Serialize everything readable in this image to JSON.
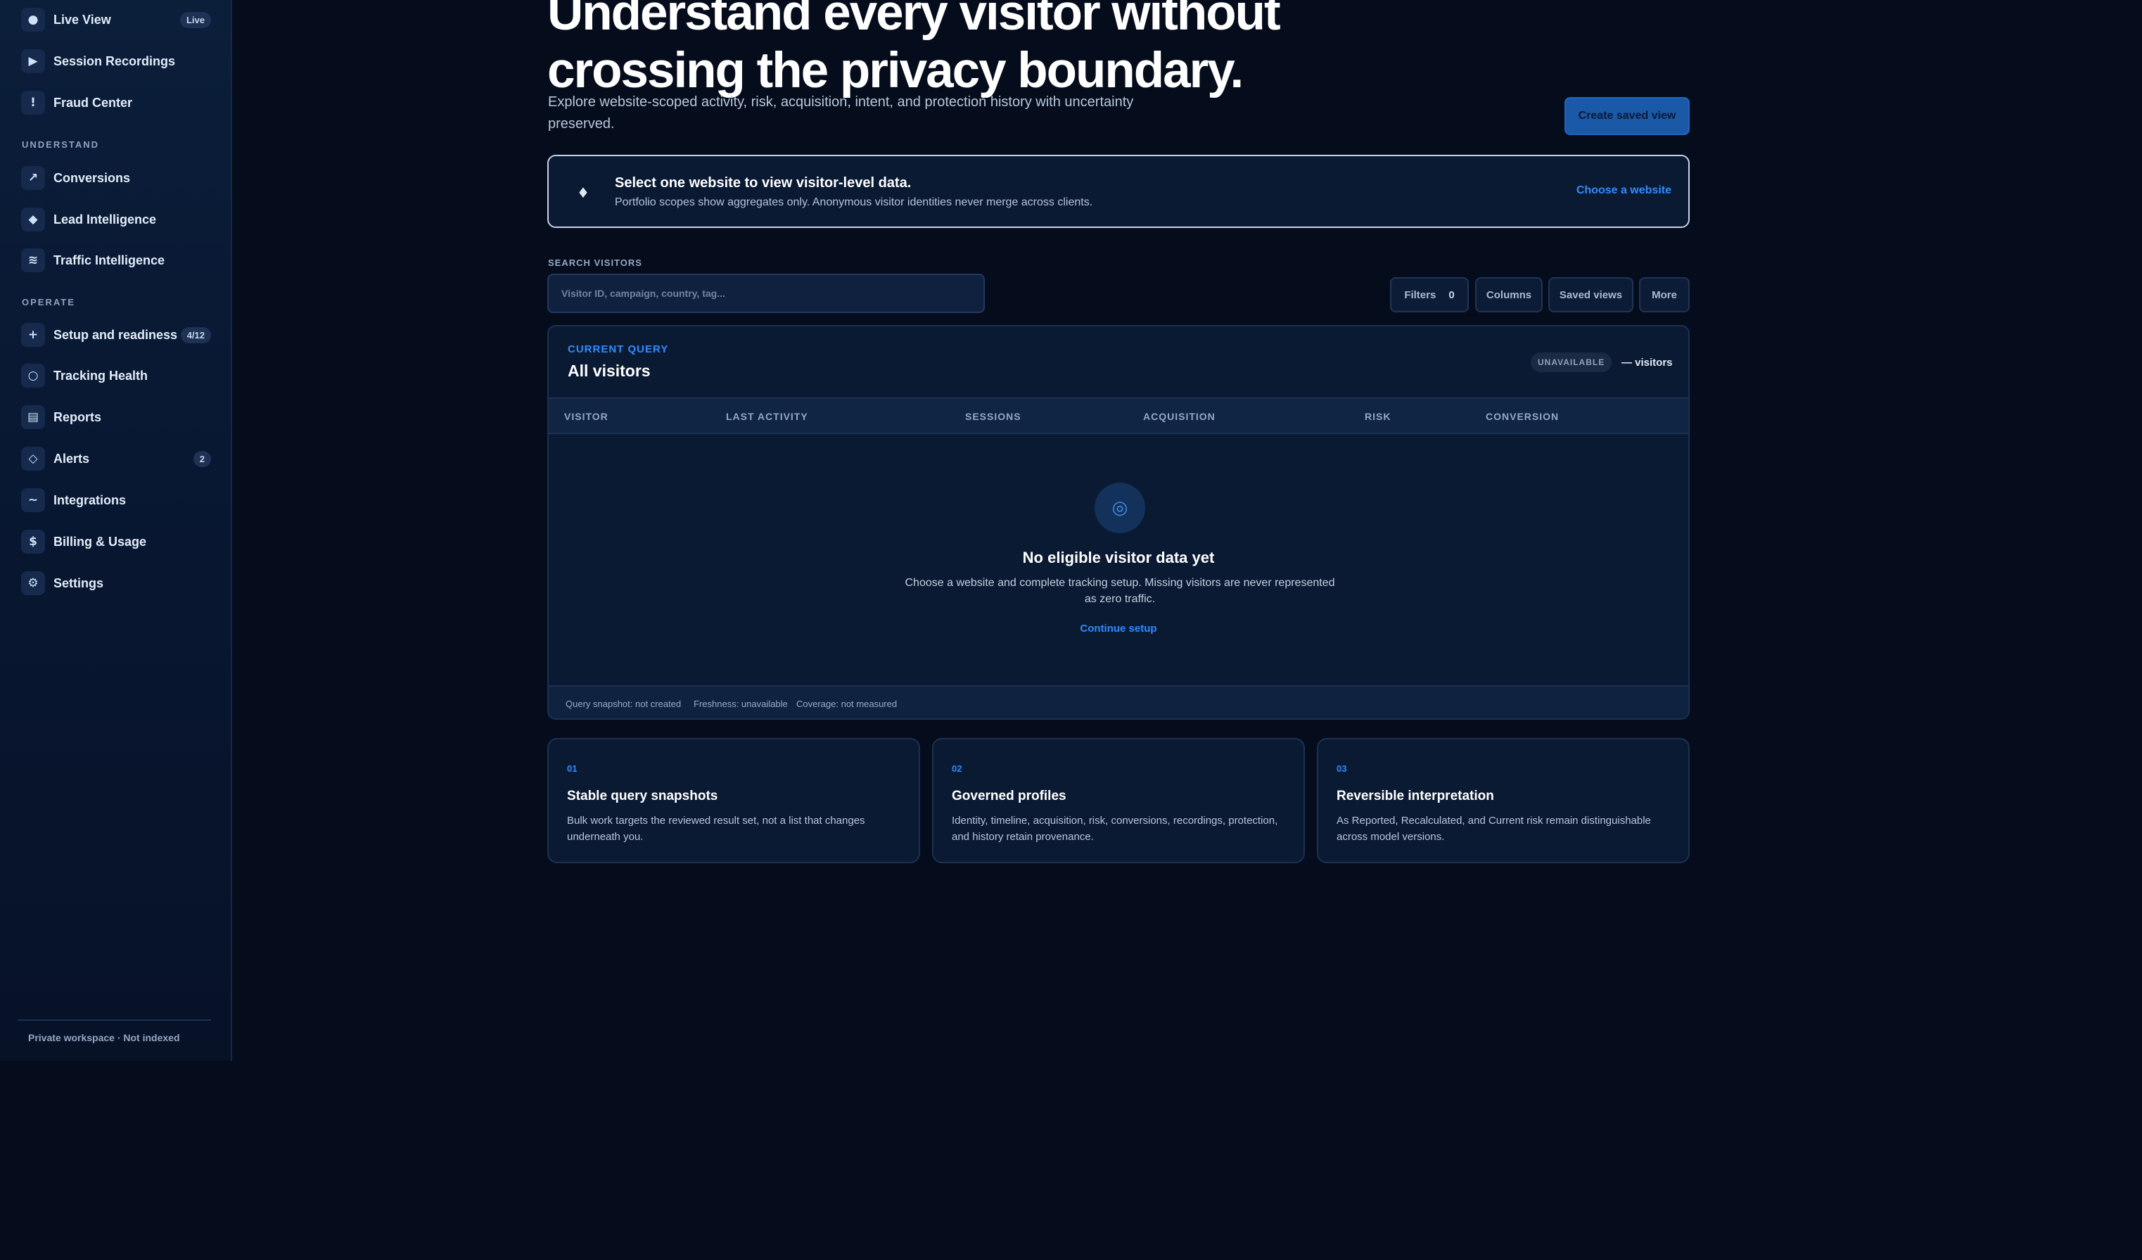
{
  "sidebar": {
    "items_top": [
      {
        "icon": "dot-icon",
        "glyph": "●",
        "label": "Live View",
        "badge": "Live"
      },
      {
        "icon": "play-icon",
        "glyph": "▶",
        "label": "Session Recordings"
      },
      {
        "icon": "alert-icon",
        "glyph": "!",
        "label": "Fraud Center"
      }
    ],
    "section_understand": "UNDERSTAND",
    "items_understand": [
      {
        "icon": "trend-icon",
        "glyph": "↗",
        "label": "Conversions"
      },
      {
        "icon": "diamond-icon",
        "glyph": "◆",
        "label": "Lead Intelligence"
      },
      {
        "icon": "waves-icon",
        "glyph": "≋",
        "label": "Traffic Intelligence"
      }
    ],
    "section_operate": "OPERATE",
    "items_operate": [
      {
        "icon": "plus-icon",
        "glyph": "+",
        "label": "Setup and readiness",
        "badge": "4/12"
      },
      {
        "icon": "health-icon",
        "glyph": "○",
        "label": "Tracking Health"
      },
      {
        "icon": "report-icon",
        "glyph": "▤",
        "label": "Reports"
      },
      {
        "icon": "alerts-icon",
        "glyph": "◇",
        "label": "Alerts",
        "badge": "2"
      },
      {
        "icon": "integrations-icon",
        "glyph": "~",
        "label": "Integrations"
      },
      {
        "icon": "dollar-icon",
        "glyph": "$",
        "label": "Billing & Usage"
      },
      {
        "icon": "gear-icon",
        "glyph": "⚙",
        "label": "Settings"
      }
    ],
    "footer": "Private workspace · Not indexed"
  },
  "hero": {
    "title_line1": "Understand every visitor without",
    "title_line2": "crossing the privacy boundary.",
    "subtitle": "Explore website-scoped activity, risk, acquisition, intent, and protection history with uncertainty preserved.",
    "cta": "Create saved view"
  },
  "notice": {
    "icon": "♦",
    "title": "Select one website to view visitor-level data.",
    "text": "Portfolio scopes show aggregates only. Anonymous visitor identities never merge across clients.",
    "link": "Choose a website"
  },
  "search": {
    "label": "SEARCH VISITORS",
    "placeholder": "Visitor ID, campaign, country, tag..."
  },
  "toolbar": {
    "filters": "Filters",
    "filters_count": "0",
    "columns": "Columns",
    "saved_views": "Saved views",
    "more": "More"
  },
  "query": {
    "label": "CURRENT QUERY",
    "title": "All visitors",
    "status": "UNAVAILABLE",
    "count": "— visitors"
  },
  "table": {
    "columns": [
      "VISITOR",
      "LAST ACTIVITY",
      "SESSIONS",
      "ACQUISITION",
      "RISK",
      "CONVERSION"
    ]
  },
  "empty": {
    "icon": "◎",
    "title": "No eligible visitor data yet",
    "text": "Choose a website and complete tracking setup. Missing visitors are never represented as zero traffic.",
    "link": "Continue setup"
  },
  "footer_meta": {
    "snapshot": "Query snapshot: not created",
    "freshness": "Freshness: unavailable",
    "coverage": "Coverage: not measured"
  },
  "features": [
    {
      "num": "01",
      "title": "Stable query snapshots",
      "text": "Bulk work targets the reviewed result set, not a list that changes underneath you."
    },
    {
      "num": "02",
      "title": "Governed profiles",
      "text": "Identity, timeline, acquisition, risk, conversions, recordings, protection, and history retain provenance."
    },
    {
      "num": "03",
      "title": "Reversible interpretation",
      "text": "As Reported, Recalculated, and Current risk remain distinguishable across model versions."
    }
  ]
}
